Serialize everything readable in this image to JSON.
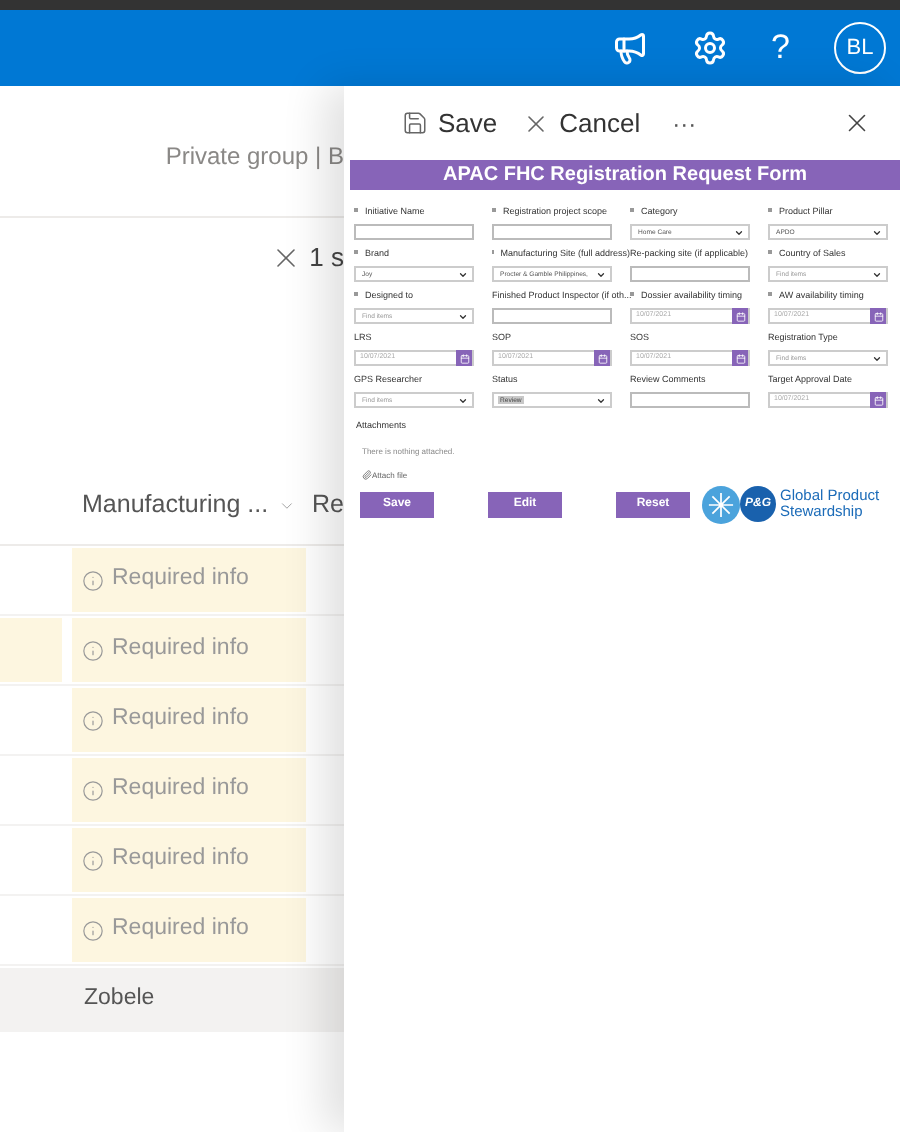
{
  "header_bar": {
    "help": "?",
    "avatar": "BL"
  },
  "page": {
    "group_label": "Private group | B",
    "selection": "1 s",
    "table": {
      "columns": [
        {
          "label": "Manufacturing ..."
        },
        {
          "label": "Re"
        }
      ],
      "rows": [
        {
          "required": "Required info",
          "left_flag": false
        },
        {
          "required": "Required info",
          "left_flag": true
        },
        {
          "required": "Required info",
          "left_flag": false
        },
        {
          "required": "Required info",
          "left_flag": false
        },
        {
          "required": "Required info",
          "left_flag": false
        },
        {
          "required": "Required info",
          "left_flag": false
        }
      ],
      "footer_row": "Zobele"
    }
  },
  "panel": {
    "commands": [
      {
        "kind": "save",
        "label": "Save"
      },
      {
        "kind": "cancel",
        "label": "Cancel"
      },
      {
        "kind": "more",
        "label": "···"
      }
    ],
    "form": {
      "title": "APAC FHC Registration Request Form",
      "fields": [
        {
          "label": "Initiative Name",
          "required": true,
          "kind": "text"
        },
        {
          "label": "Registration project scope",
          "required": true,
          "kind": "text"
        },
        {
          "label": "Category",
          "required": true,
          "kind": "dropdown",
          "value": "Home Care"
        },
        {
          "label": "Product Pillar",
          "required": true,
          "kind": "dropdown",
          "value": "APDO"
        },
        {
          "label": "Brand",
          "required": true,
          "kind": "dropdown",
          "value": "Joy"
        },
        {
          "label": "Manufacturing Site (full address)",
          "required": true,
          "kind": "dropdown",
          "value": "Procter & Gamble Philippines,"
        },
        {
          "label": "Re-packing site (if applicable)",
          "required": false,
          "kind": "text"
        },
        {
          "label": "Country of Sales",
          "required": true,
          "kind": "dropdown",
          "placeholder": "Find items"
        },
        {
          "label": "Designed to",
          "required": true,
          "kind": "dropdown",
          "placeholder": "Find items"
        },
        {
          "label": "Finished Product Inspector (if oth...",
          "required": false,
          "kind": "text"
        },
        {
          "label": "Dossier availability timing",
          "required": true,
          "kind": "date",
          "placeholder": "10/07/2021"
        },
        {
          "label": "AW availability timing",
          "required": true,
          "kind": "date",
          "placeholder": "10/07/2021"
        },
        {
          "label": "LRS",
          "required": false,
          "kind": "date",
          "placeholder": "10/07/2021"
        },
        {
          "label": "SOP",
          "required": false,
          "kind": "date",
          "placeholder": "10/07/2021"
        },
        {
          "label": "SOS",
          "required": false,
          "kind": "date",
          "placeholder": "10/07/2021"
        },
        {
          "label": "Registration Type",
          "required": false,
          "kind": "dropdown",
          "placeholder": "Find items"
        },
        {
          "label": "GPS Researcher",
          "required": false,
          "kind": "dropdown",
          "placeholder": "Find items"
        },
        {
          "label": "Status",
          "required": false,
          "kind": "dropdown",
          "value": "Review",
          "disabled": true
        },
        {
          "label": "Review Comments",
          "required": false,
          "kind": "text"
        },
        {
          "label": "Target Approval Date",
          "required": false,
          "kind": "date",
          "placeholder": "10/07/2021"
        }
      ],
      "attachments": {
        "label": "Attachments",
        "empty": "There is nothing attached.",
        "attach": "Attach file"
      },
      "buttons": [
        "Save",
        "Edit",
        "Reset"
      ],
      "logo": {
        "badge": "P&G",
        "line1": "Global Product",
        "line2": "Stewardship"
      }
    }
  }
}
